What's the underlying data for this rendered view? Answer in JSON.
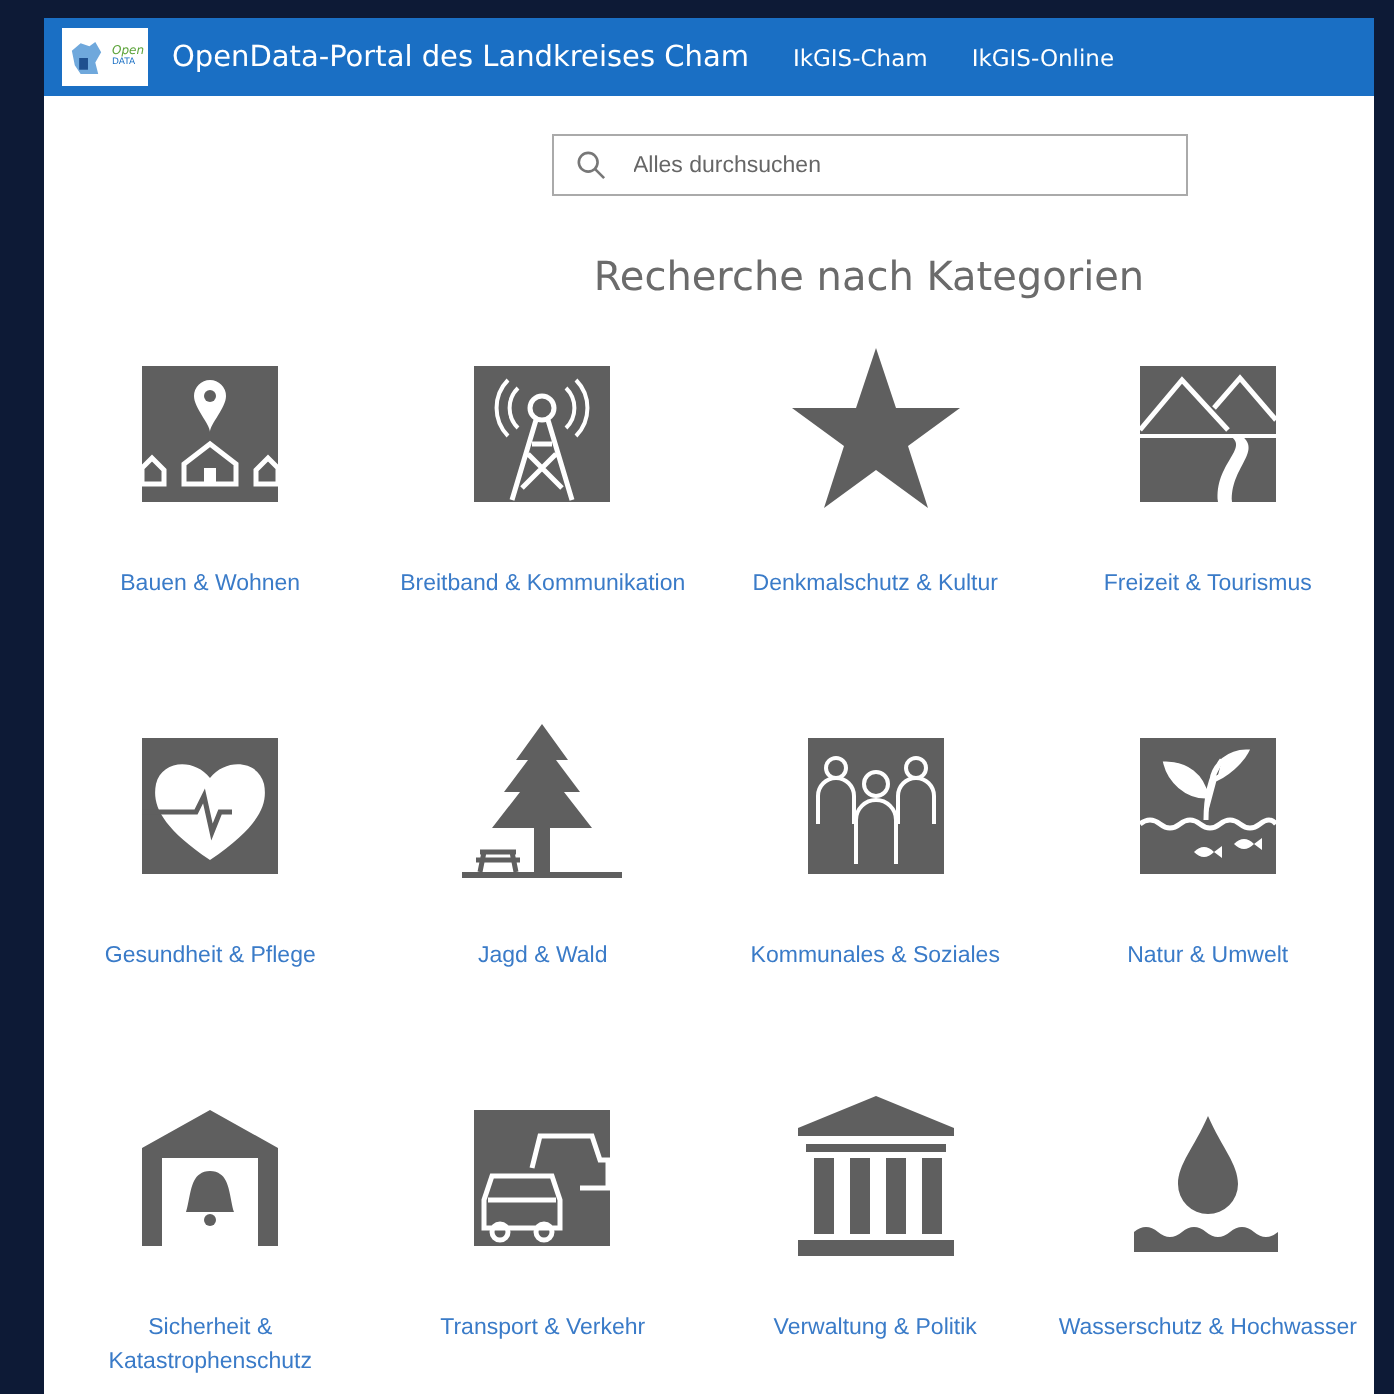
{
  "header": {
    "logo_text": [
      "Open",
      "DATA"
    ],
    "title": "OpenData-Portal des Landkreises Cham",
    "links": [
      "IkGIS-Cham",
      "IkGIS-Online"
    ]
  },
  "search": {
    "placeholder": "Alles durchsuchen"
  },
  "heading": "Recherche nach Kategorien",
  "categories": [
    {
      "label": "Bauen & Wohnen",
      "kind": "houses"
    },
    {
      "label": "Breitband & Kommunikation",
      "kind": "tower"
    },
    {
      "label": "Denkmalschutz & Kultur",
      "kind": "star"
    },
    {
      "label": "Freizeit & Tourismus",
      "kind": "mountains"
    },
    {
      "label": "Gesundheit & Pflege",
      "kind": "heart"
    },
    {
      "label": "Jagd & Wald",
      "kind": "tree"
    },
    {
      "label": "Kommunales & Soziales",
      "kind": "people"
    },
    {
      "label": "Natur & Umwelt",
      "kind": "plant"
    },
    {
      "label": "Sicherheit & Katastrophenschutz",
      "kind": "bell"
    },
    {
      "label": "Transport & Verkehr",
      "kind": "cars"
    },
    {
      "label": "Verwaltung & Politik",
      "kind": "building"
    },
    {
      "label": "Wasserschutz & Hochwasser",
      "kind": "drop"
    }
  ]
}
